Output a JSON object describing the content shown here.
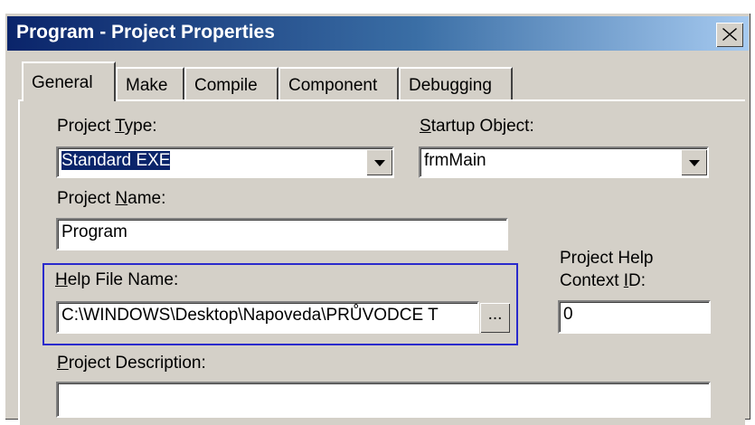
{
  "window": {
    "title": "Program - Project Properties"
  },
  "tabs": [
    {
      "label": "General"
    },
    {
      "label": "Make"
    },
    {
      "label": "Compile"
    },
    {
      "label": "Component"
    },
    {
      "label": "Debugging"
    }
  ],
  "general": {
    "project_type": {
      "label_pre": "Project ",
      "label_key": "T",
      "label_post": "ype:",
      "value": "Standard EXE"
    },
    "startup_object": {
      "label_key": "S",
      "label_post": "tartup Object:",
      "value": "frmMain"
    },
    "project_name": {
      "label_pre": "Project ",
      "label_key": "N",
      "label_post": "ame:",
      "value": "Program"
    },
    "help_file": {
      "label_key": "H",
      "label_post": "elp File Name:",
      "value": "C:\\WINDOWS\\Desktop\\Napoveda\\PRŮVODCE T",
      "browse_label": "..."
    },
    "help_context": {
      "label_line1": "Project Help",
      "label_pre": "Context ",
      "label_key": "I",
      "label_post": "D:",
      "value": "0"
    },
    "project_description": {
      "label_key": "P",
      "label_post": "roject Description:",
      "value": ""
    }
  },
  "icons": {
    "close": "close-icon",
    "dropdown": "chevron-down-icon"
  },
  "colors": {
    "title_bar": "#0a246a",
    "selection": "#0a246a",
    "highlight_border": "#2a2acc",
    "face": "#d4d0c8"
  }
}
